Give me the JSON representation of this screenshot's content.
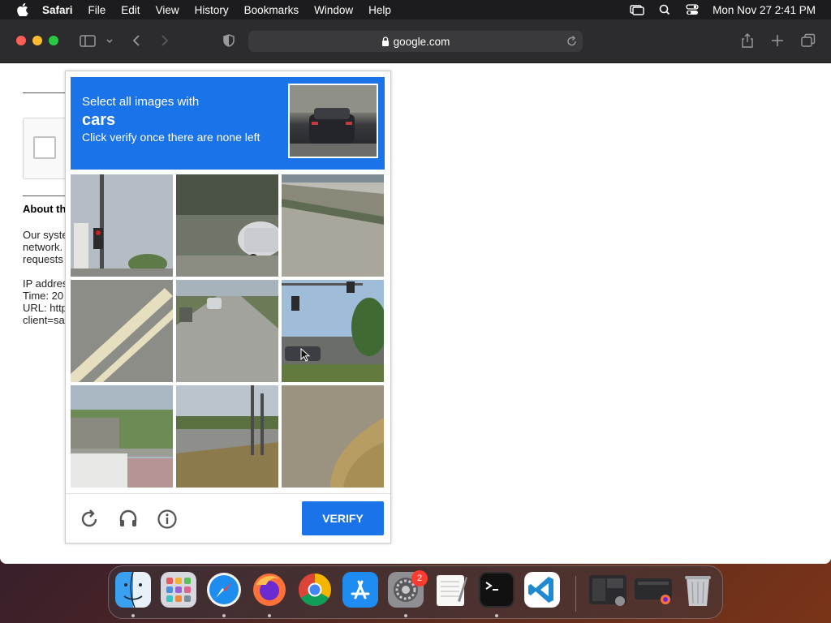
{
  "menubar": {
    "app_name": "Safari",
    "items": [
      "File",
      "Edit",
      "View",
      "History",
      "Bookmarks",
      "Window",
      "Help"
    ],
    "clock": "Mon Nov 27  2:41 PM"
  },
  "browser": {
    "url": "google.com"
  },
  "page": {
    "about_heading": "About th",
    "para_lines": [
      "Our syste",
      "network.",
      "requests"
    ],
    "info_lines": [
      "IP addres",
      "Time: 20",
      "URL: http",
      "client=sa"
    ]
  },
  "captcha": {
    "prompt_line1": "Select all images with",
    "target_word": "cars",
    "prompt_line3": "Click verify once there are none left",
    "verify_label": "VERIFY",
    "colors": {
      "accent": "#1a73e8"
    }
  },
  "dock": {
    "settings_badge": "2",
    "apps": [
      "finder-icon",
      "launchpad-icon",
      "safari-icon",
      "firefox-icon",
      "chrome-icon",
      "app-store-icon",
      "system-settings-icon",
      "textedit-icon",
      "terminal-icon",
      "vscode-icon",
      "window-thumbnail-icon",
      "firefox-window-thumbnail-icon",
      "trash-icon"
    ]
  }
}
